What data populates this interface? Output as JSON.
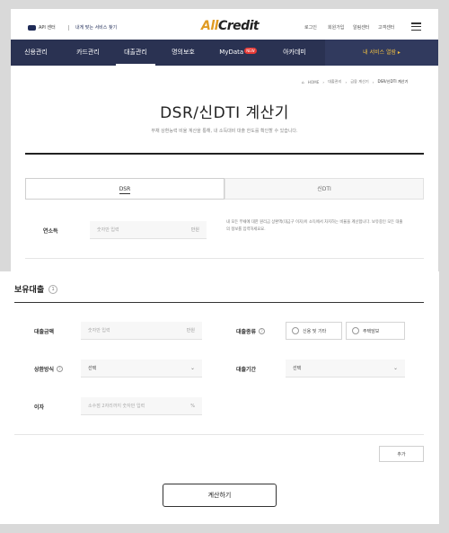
{
  "header": {
    "api_center": "API 센터",
    "tagline": "내게 맞는 서비스 찾기",
    "logo_a": "All",
    "logo_b": "Credit",
    "utils": [
      "로그인",
      "회원가입",
      "알림센터",
      "고객센터"
    ]
  },
  "nav": {
    "items": [
      "신용관리",
      "카드관리",
      "대출관리",
      "명의보호",
      "MyData",
      "아카데미"
    ],
    "mydata_badge": "NEW",
    "active": "대출관리",
    "cta": "내 서비스 열람 ▸"
  },
  "breadcrumb": [
    "HOME",
    "대출관리",
    "금융 계산기",
    "DSR/신DTI 계산기"
  ],
  "page": {
    "title": "DSR/신DTI 계산기",
    "subtitle": "부채 상환능력 비율 계산을 통해, 내 소득대비 대출 한도를 확인할 수 있습니다."
  },
  "tabs": [
    {
      "label": "DSR",
      "active": true
    },
    {
      "label": "신DTI",
      "active": false
    }
  ],
  "income": {
    "label": "연소득",
    "placeholder": "숫자만 입력",
    "unit": "만원",
    "note": "내 모든 부채에 대한 원리금 상환액(대금구 이자)이 소득에서 차지하는 비율을 계산합니다. 보유중인 모든 대출의 정보를 입력하세요요."
  },
  "loans": {
    "title": "보유대출",
    "count": "1",
    "amount_label": "대출금액",
    "amount_placeholder": "숫자만 입력",
    "amount_unit": "만원",
    "type_label": "대출종류",
    "type_options": [
      "신용 및 기타",
      "주택담보"
    ],
    "repay_label": "상환방식",
    "repay_value": "선택",
    "period_label": "대출기간",
    "period_value": "선택",
    "rate_label": "이자",
    "rate_placeholder": "소수점 2자리까지 숫자만 입력",
    "rate_unit": "%",
    "add_label": "추가"
  },
  "calc_label": "계산하기"
}
